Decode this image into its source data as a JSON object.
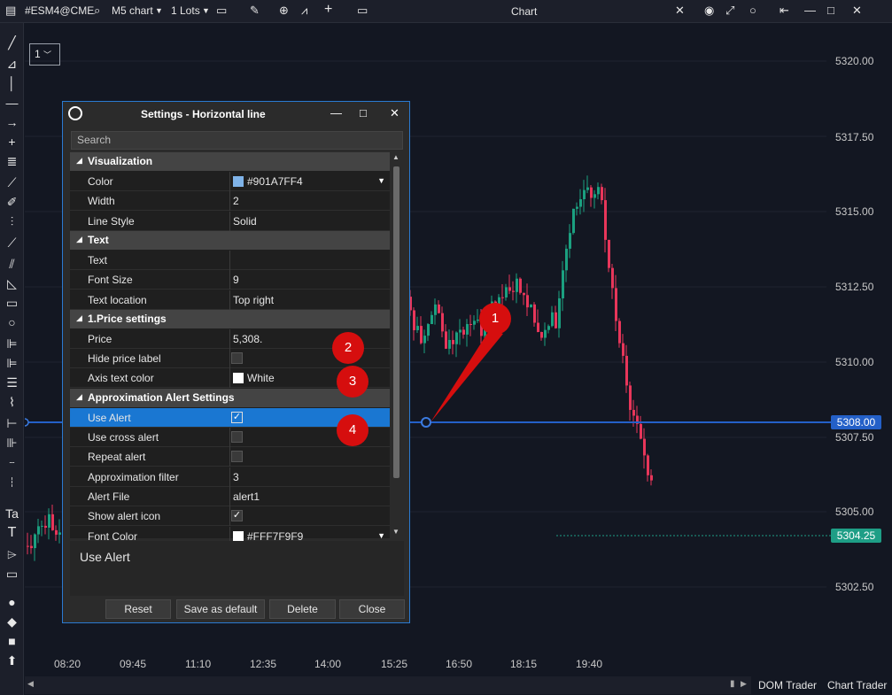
{
  "toolbar": {
    "symbol": "#ESM4@CME",
    "chart_type": "M5 chart",
    "lots": "1 Lots",
    "title": "Chart"
  },
  "chart": {
    "zoom_label": "1",
    "price_labels": [
      "5320.00",
      "5317.50",
      "5315.00",
      "5312.50",
      "5310.00",
      "5307.50",
      "5305.00",
      "5302.50"
    ],
    "time_labels": [
      "08:20",
      "09:45",
      "11:10",
      "12:35",
      "14:00",
      "15:25",
      "16:50",
      "18:15",
      "19:40"
    ],
    "line_price_tag": "5308.00",
    "last_price_tag": "5304.25",
    "line_color": "#2460c8",
    "last_price_color": "#1e9e86"
  },
  "bottom": {
    "dom_trader": "DOM Trader",
    "chart_trader": "Chart Trader"
  },
  "dialog": {
    "title": "Settings - Horizontal line",
    "search_placeholder": "Search",
    "rows": [
      {
        "type": "cat",
        "label": "Visualization"
      },
      {
        "type": "row",
        "label": "Color",
        "value": "#901A7FF4",
        "swatch": "#7fb3e8",
        "dropdown": true
      },
      {
        "type": "row",
        "label": "Width",
        "value": "2"
      },
      {
        "type": "row",
        "label": "Line Style",
        "value": "Solid"
      },
      {
        "type": "cat",
        "label": "Text"
      },
      {
        "type": "row",
        "label": "Text",
        "value": ""
      },
      {
        "type": "row",
        "label": "Font Size",
        "value": "9"
      },
      {
        "type": "row",
        "label": "Text location",
        "value": "Top right"
      },
      {
        "type": "cat",
        "label": "1.Price settings"
      },
      {
        "type": "row",
        "label": "Price",
        "value": "5,308."
      },
      {
        "type": "row",
        "label": "Hide price label",
        "check": false
      },
      {
        "type": "row",
        "label": "Axis text color",
        "value": "White",
        "swatch": "#ffffff"
      },
      {
        "type": "cat",
        "label": "Approximation Alert Settings"
      },
      {
        "type": "row",
        "label": "Use Alert",
        "check": true,
        "selected": true
      },
      {
        "type": "row",
        "label": "Use cross alert",
        "check": false
      },
      {
        "type": "row",
        "label": "Repeat alert",
        "check": false
      },
      {
        "type": "row",
        "label": "Approximation filter",
        "value": "3"
      },
      {
        "type": "row",
        "label": "Alert File",
        "value": "alert1"
      },
      {
        "type": "row",
        "label": "Show alert icon",
        "check": true
      },
      {
        "type": "row",
        "label": "Font Color",
        "value": "#FFF7F9F9",
        "swatch": "#ffffff",
        "dropdown": true
      }
    ],
    "description": "Use Alert",
    "buttons": {
      "reset": "Reset",
      "save_default": "Save as default",
      "delete": "Delete",
      "close": "Close"
    }
  },
  "callouts": [
    "1",
    "2",
    "3",
    "4"
  ]
}
